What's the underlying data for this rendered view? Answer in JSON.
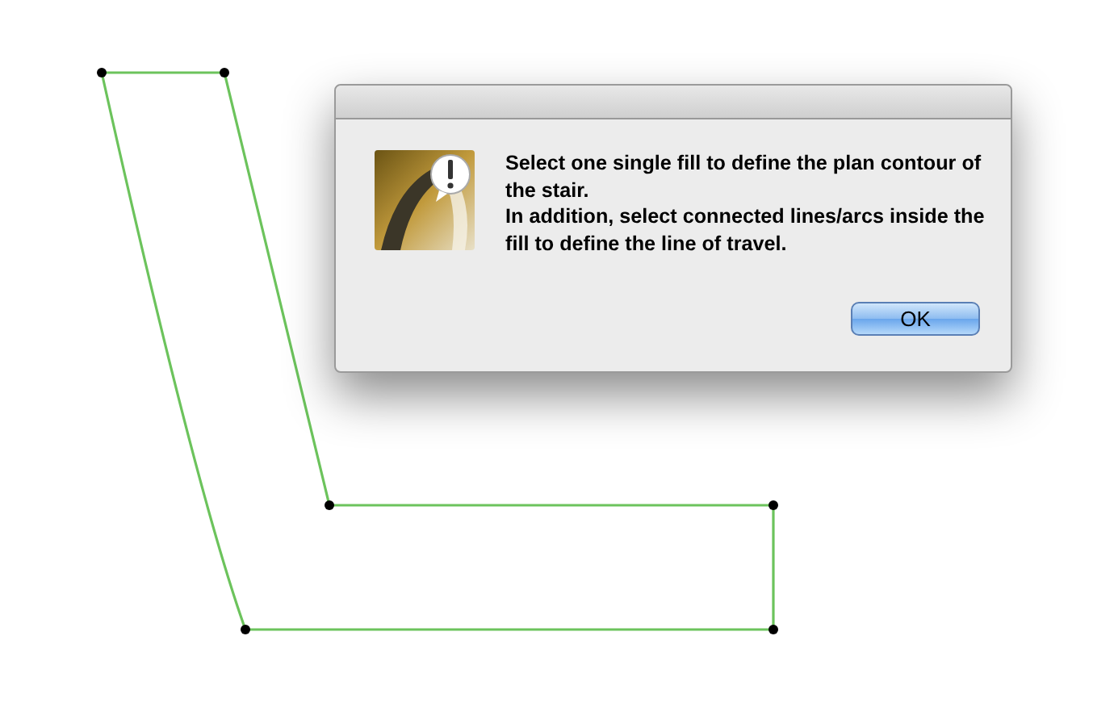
{
  "dialog": {
    "message": [
      "Select one single fill to define the plan contour of the stair.",
      "In addition, select connected lines/arcs inside the fill to define the line of travel."
    ],
    "buttons": [
      {
        "label": "OK",
        "default": true
      }
    ]
  }
}
